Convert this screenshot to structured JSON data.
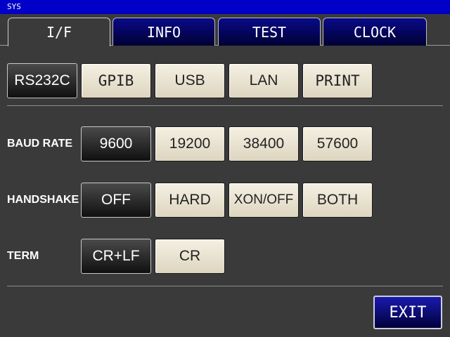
{
  "window": {
    "title": "SYS"
  },
  "tabs": [
    {
      "label": "I/F",
      "active": true
    },
    {
      "label": "INFO",
      "active": false
    },
    {
      "label": "TEST",
      "active": false
    },
    {
      "label": "CLOCK",
      "active": false
    }
  ],
  "interfaces": [
    {
      "label": "RS232C",
      "selected": true
    },
    {
      "label": "GPIB",
      "selected": false
    },
    {
      "label": "USB",
      "selected": false
    },
    {
      "label": "LAN",
      "selected": false
    },
    {
      "label": "PRINT",
      "selected": false
    }
  ],
  "baud_rate": {
    "label": "BAUD RATE",
    "options": [
      {
        "label": "9600",
        "selected": true
      },
      {
        "label": "19200",
        "selected": false
      },
      {
        "label": "38400",
        "selected": false
      },
      {
        "label": "57600",
        "selected": false
      }
    ]
  },
  "handshake": {
    "label": "HANDSHAKE",
    "options": [
      {
        "label": "OFF",
        "selected": true
      },
      {
        "label": "HARD",
        "selected": false
      },
      {
        "label": "XON/OFF",
        "selected": false
      },
      {
        "label": "BOTH",
        "selected": false
      }
    ]
  },
  "term": {
    "label": "TERM",
    "options": [
      {
        "label": "CR+LF",
        "selected": true
      },
      {
        "label": "CR",
        "selected": false
      }
    ]
  },
  "exit_label": "EXIT",
  "colors": {
    "background": "#3a3a3a",
    "titlebar": "#0000c8",
    "tab_inactive": "#0a0a8a",
    "button_off": "#ece6d4",
    "button_on": "#202020",
    "exit_button": "#1a1ab0"
  }
}
